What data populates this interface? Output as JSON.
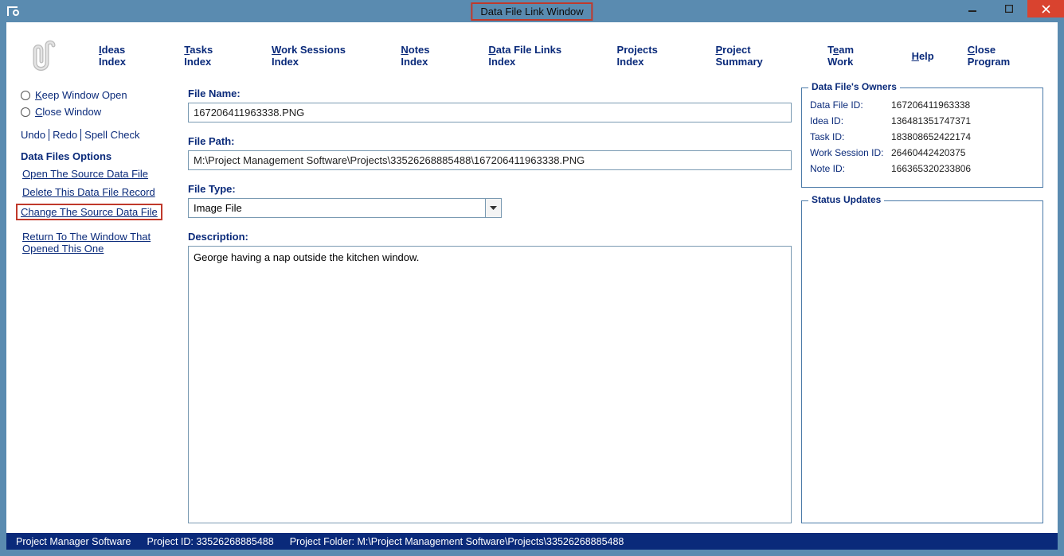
{
  "window": {
    "title": "Data File Link Window"
  },
  "nav": {
    "ideas": "Ideas Index",
    "tasks": "Tasks Index",
    "work_sessions": "Work Sessions Index",
    "notes": "Notes Index",
    "data_file_links": "Data File Links Index",
    "projects": "Projects Index",
    "project_summary": "Project Summary",
    "team_work": "Team Work",
    "help": "Help",
    "close_program": "Close Program"
  },
  "sidebar": {
    "keep_window_open": "Keep Window Open",
    "close_window": "Close Window",
    "undo": "Undo",
    "redo": "Redo",
    "spell_check": "Spell Check",
    "options_title": "Data Files Options",
    "open_source": "Open The Source Data File",
    "delete_record": "Delete This Data File Record",
    "change_source": "Change The Source Data File",
    "return_window": "Return To The Window That Opened This One"
  },
  "form": {
    "file_name_label": "File Name:",
    "file_name_value": "167206411963338.PNG",
    "file_path_label": "File Path:",
    "file_path_value": "M:\\Project Management Software\\Projects\\33526268885488\\167206411963338.PNG",
    "file_type_label": "File Type:",
    "file_type_value": "Image File",
    "description_label": "Description:",
    "description_value": "George having a nap outside the kitchen window."
  },
  "owners": {
    "legend": "Data File's Owners",
    "rows": [
      {
        "key": "Data File ID:",
        "val": "167206411963338"
      },
      {
        "key": "Idea ID:",
        "val": "136481351747371"
      },
      {
        "key": "Task ID:",
        "val": "183808652422174"
      },
      {
        "key": "Work Session ID:",
        "val": "26460442420375"
      },
      {
        "key": "Note ID:",
        "val": "166365320233806"
      }
    ]
  },
  "status_updates": {
    "legend": "Status Updates"
  },
  "statusbar": {
    "app": "Project Manager Software",
    "project_id_label": "Project ID:",
    "project_id": "33526268885488",
    "project_folder_label": "Project Folder:",
    "project_folder": "M:\\Project Management Software\\Projects\\33526268885488"
  }
}
